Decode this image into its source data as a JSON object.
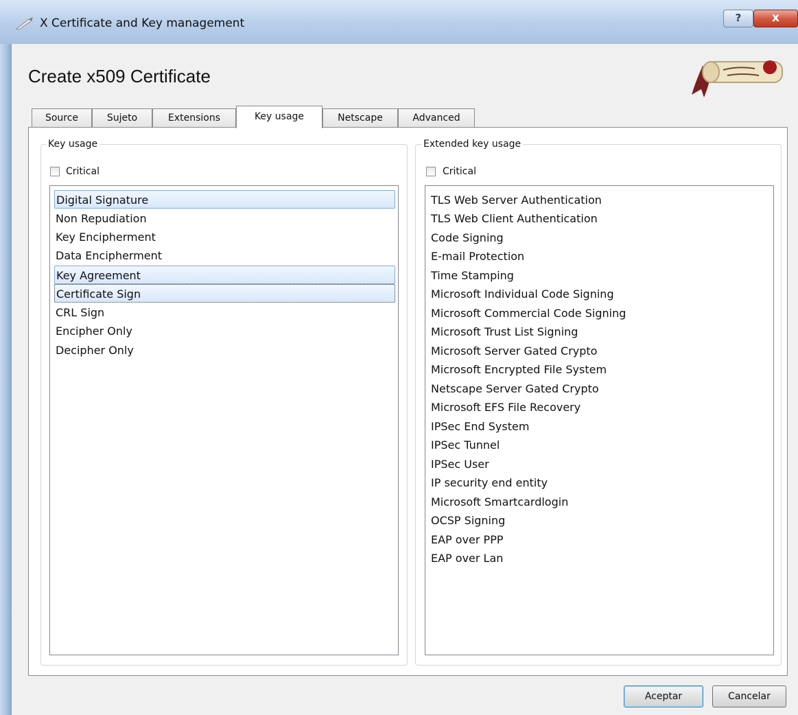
{
  "window": {
    "title": "X Certificate and Key management",
    "help_glyph": "?",
    "close_glyph": "x"
  },
  "dialog": {
    "heading": "Create x509 Certificate"
  },
  "tabs": [
    {
      "label": "Source"
    },
    {
      "label": "Sujeto"
    },
    {
      "label": "Extensions"
    },
    {
      "label": "Key usage",
      "active": true
    },
    {
      "label": "Netscape"
    },
    {
      "label": "Advanced"
    }
  ],
  "key_usage": {
    "title": "Key usage",
    "critical_label": "Critical",
    "critical_checked": false,
    "items": [
      {
        "label": "Digital Signature",
        "selected": true
      },
      {
        "label": "Non Repudiation",
        "selected": false
      },
      {
        "label": "Key Encipherment",
        "selected": false
      },
      {
        "label": "Data Encipherment",
        "selected": false
      },
      {
        "label": "Key Agreement",
        "selected": true
      },
      {
        "label": "Certificate Sign",
        "selected": true,
        "focused": true
      },
      {
        "label": "CRL Sign",
        "selected": false
      },
      {
        "label": "Encipher Only",
        "selected": false
      },
      {
        "label": "Decipher Only",
        "selected": false
      }
    ]
  },
  "extended_key_usage": {
    "title": "Extended key usage",
    "critical_label": "Critical",
    "critical_checked": false,
    "items": [
      {
        "label": "TLS Web Server Authentication"
      },
      {
        "label": "TLS Web Client Authentication"
      },
      {
        "label": "Code Signing"
      },
      {
        "label": "E-mail Protection"
      },
      {
        "label": "Time Stamping"
      },
      {
        "label": "Microsoft Individual Code Signing"
      },
      {
        "label": "Microsoft Commercial Code Signing"
      },
      {
        "label": "Microsoft Trust List Signing"
      },
      {
        "label": "Microsoft Server Gated Crypto"
      },
      {
        "label": "Microsoft Encrypted File System"
      },
      {
        "label": "Netscape Server Gated Crypto"
      },
      {
        "label": "Microsoft EFS File Recovery"
      },
      {
        "label": "IPSec End System"
      },
      {
        "label": "IPSec Tunnel"
      },
      {
        "label": "IPSec User"
      },
      {
        "label": "IP security end entity"
      },
      {
        "label": "Microsoft Smartcardlogin"
      },
      {
        "label": "OCSP Signing"
      },
      {
        "label": "EAP over PPP"
      },
      {
        "label": "EAP over Lan"
      }
    ]
  },
  "buttons": {
    "ok": "Aceptar",
    "cancel": "Cancelar"
  },
  "colors": {
    "selection_fill": "#d7e8fb",
    "selection_border": "#84acdd",
    "close_button": "#c0391f"
  },
  "icons": {
    "title": "certificate-pen-icon",
    "logo": "scroll-seal-logo"
  }
}
